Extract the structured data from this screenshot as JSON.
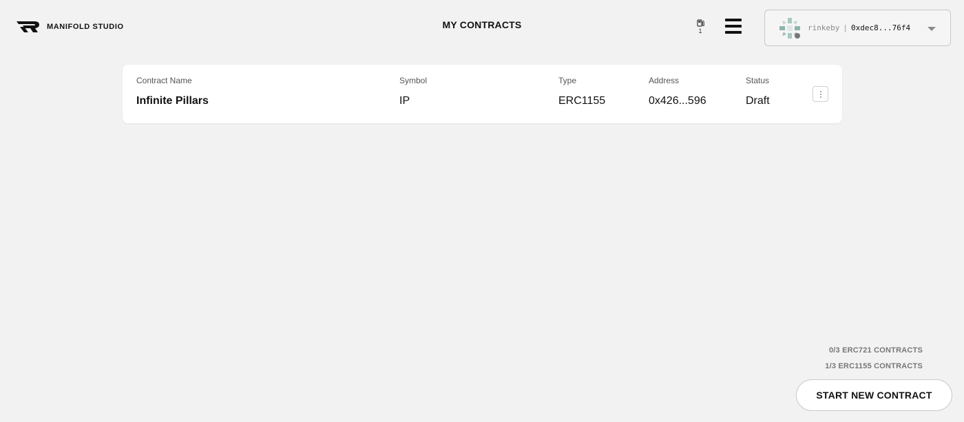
{
  "header": {
    "logo_text": "MANIFOLD STUDIO",
    "page_title": "MY CONTRACTS",
    "gas_count": "1",
    "wallet": {
      "network": "rinkeby",
      "separator": "|",
      "address": "0xdec8...76f4"
    }
  },
  "contracts": {
    "columns": {
      "name": "Contract Name",
      "symbol": "Symbol",
      "type": "Type",
      "address": "Address",
      "status": "Status"
    },
    "rows": [
      {
        "name": "Infinite Pillars",
        "symbol": "IP",
        "type": "ERC1155",
        "address": "0x426...596",
        "status": "Draft"
      }
    ]
  },
  "footer": {
    "erc721_count": "0/3 ERC721 CONTRACTS",
    "erc1155_count": "1/3 ERC1155 CONTRACTS",
    "start_button": "START NEW CONTRACT"
  },
  "icons": {
    "logo": "manifold-logo-icon",
    "gas": "gas-pump-icon",
    "menu": "hamburger-menu-icon",
    "avatar": "wallet-avatar-icon",
    "dropdown": "chevron-down-icon",
    "row_menu": "more-vertical-icon"
  },
  "colors": {
    "background": "#f2f2f2",
    "card": "#ffffff",
    "text": "#111111",
    "muted": "#777777"
  }
}
